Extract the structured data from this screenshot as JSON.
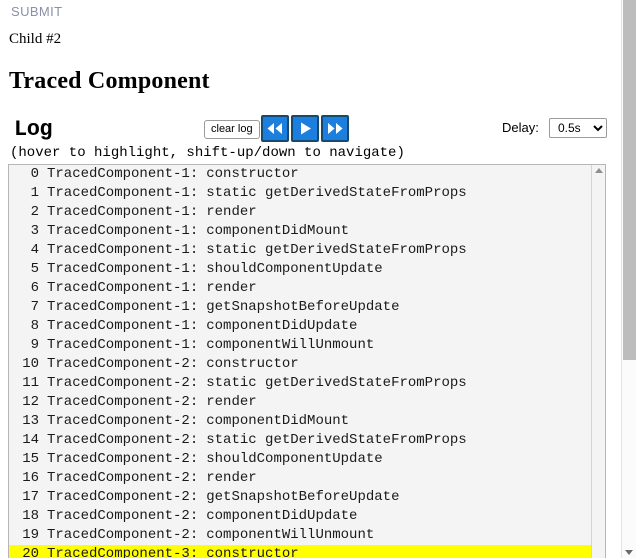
{
  "top": {
    "submit_label": "SUBMIT",
    "submit_color": "#8b8fa8",
    "child_label": "Child #2",
    "heading": "Traced Component"
  },
  "toolbar": {
    "log_title": "Log",
    "clear_log_label": "clear log",
    "rewind_icon": "rewind-icon",
    "play_icon": "play-icon",
    "fast_forward_icon": "fast-forward-icon",
    "button_color": "#1d7fdd",
    "delay_label": "Delay:",
    "delay_value": "0.5s",
    "delay_options": [
      "0.5s"
    ],
    "hover_hint": "(hover to highlight, shift-up/down to navigate)"
  },
  "log": {
    "highlight_color": "#ffff00",
    "rows": [
      {
        "index": "0",
        "component": "TracedComponent-1",
        "event": "constructor",
        "highlighted": false
      },
      {
        "index": "1",
        "component": "TracedComponent-1",
        "event": "static getDerivedStateFromProps",
        "highlighted": false
      },
      {
        "index": "2",
        "component": "TracedComponent-1",
        "event": "render",
        "highlighted": false
      },
      {
        "index": "3",
        "component": "TracedComponent-1",
        "event": "componentDidMount",
        "highlighted": false
      },
      {
        "index": "4",
        "component": "TracedComponent-1",
        "event": "static getDerivedStateFromProps",
        "highlighted": false
      },
      {
        "index": "5",
        "component": "TracedComponent-1",
        "event": "shouldComponentUpdate",
        "highlighted": false
      },
      {
        "index": "6",
        "component": "TracedComponent-1",
        "event": "render",
        "highlighted": false
      },
      {
        "index": "7",
        "component": "TracedComponent-1",
        "event": "getSnapshotBeforeUpdate",
        "highlighted": false
      },
      {
        "index": "8",
        "component": "TracedComponent-1",
        "event": "componentDidUpdate",
        "highlighted": false
      },
      {
        "index": "9",
        "component": "TracedComponent-1",
        "event": "componentWillUnmount",
        "highlighted": false
      },
      {
        "index": "10",
        "component": "TracedComponent-2",
        "event": "constructor",
        "highlighted": false
      },
      {
        "index": "11",
        "component": "TracedComponent-2",
        "event": "static getDerivedStateFromProps",
        "highlighted": false
      },
      {
        "index": "12",
        "component": "TracedComponent-2",
        "event": "render",
        "highlighted": false
      },
      {
        "index": "13",
        "component": "TracedComponent-2",
        "event": "componentDidMount",
        "highlighted": false
      },
      {
        "index": "14",
        "component": "TracedComponent-2",
        "event": "static getDerivedStateFromProps",
        "highlighted": false
      },
      {
        "index": "15",
        "component": "TracedComponent-2",
        "event": "shouldComponentUpdate",
        "highlighted": false
      },
      {
        "index": "16",
        "component": "TracedComponent-2",
        "event": "render",
        "highlighted": false
      },
      {
        "index": "17",
        "component": "TracedComponent-2",
        "event": "getSnapshotBeforeUpdate",
        "highlighted": false
      },
      {
        "index": "18",
        "component": "TracedComponent-2",
        "event": "componentDidUpdate",
        "highlighted": false
      },
      {
        "index": "19",
        "component": "TracedComponent-2",
        "event": "componentWillUnmount",
        "highlighted": false
      },
      {
        "index": "20",
        "component": "TracedComponent-3",
        "event": "constructor",
        "highlighted": true
      }
    ]
  },
  "scrollbars": {
    "inner_up_arrow": "scroll-up-arrow-icon",
    "page_down_arrow": "scroll-down-arrow-icon"
  }
}
